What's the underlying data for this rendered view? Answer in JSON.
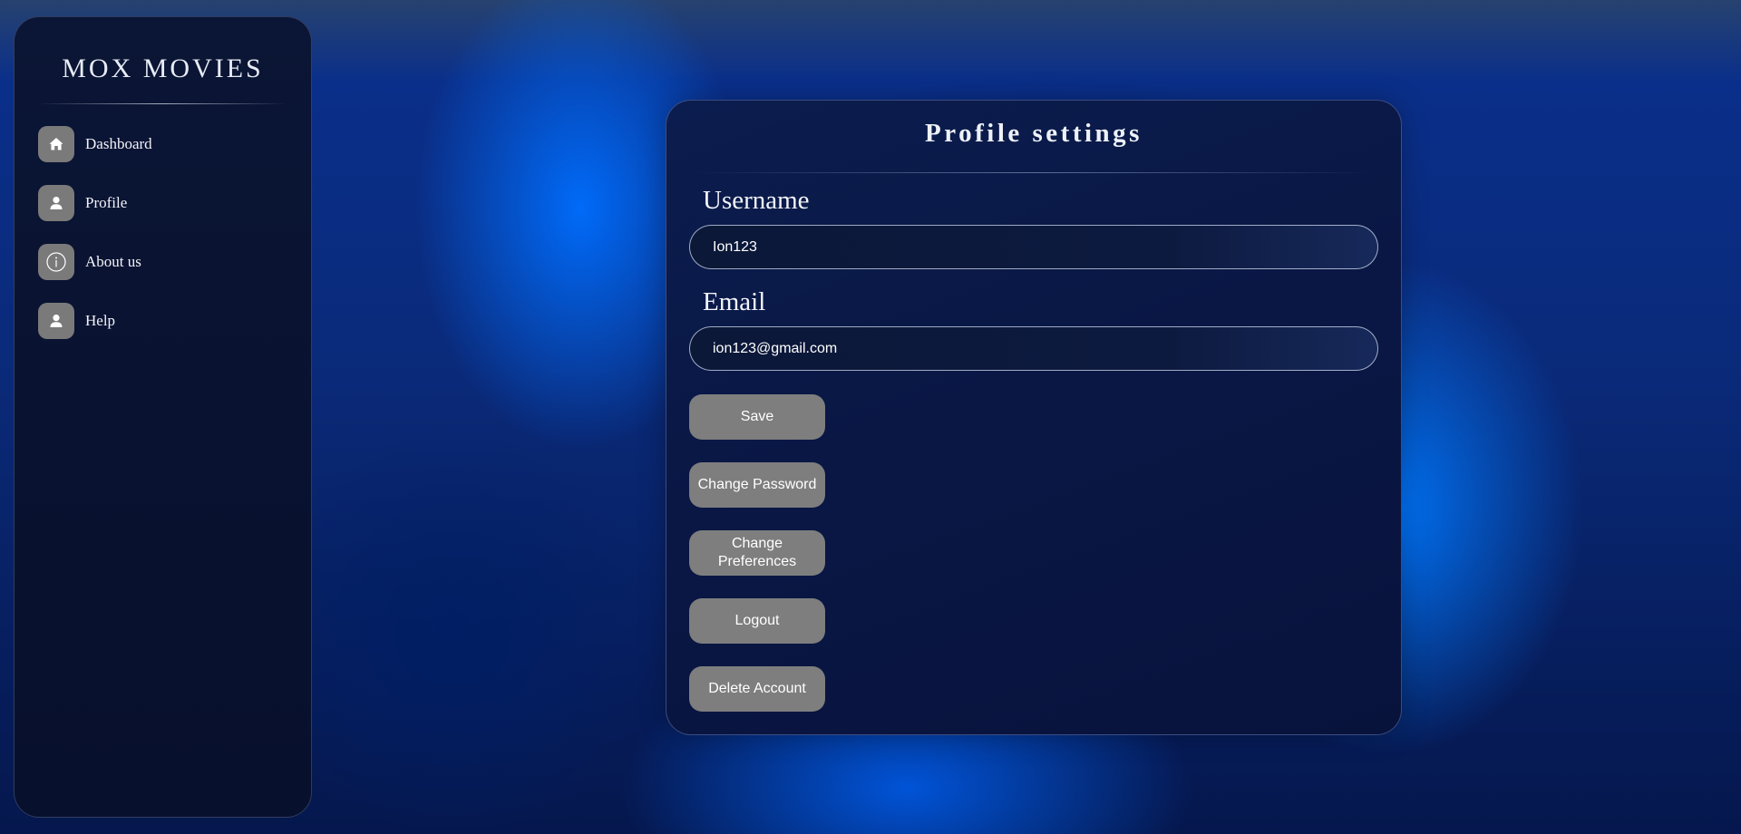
{
  "sidebar": {
    "brand": "MOX MOVIES",
    "items": [
      {
        "label": "Dashboard",
        "icon": "home-icon"
      },
      {
        "label": "Profile",
        "icon": "user-icon"
      },
      {
        "label": "About us",
        "icon": "info-icon"
      },
      {
        "label": "Help",
        "icon": "user-icon"
      }
    ]
  },
  "profile": {
    "title": "Profile settings",
    "username_label": "Username",
    "username_value": "Ion123",
    "email_label": "Email",
    "email_value": "ion123@gmail.com",
    "buttons": {
      "save": "Save",
      "change_password": "Change Password",
      "change_preferences": "Change Preferences",
      "logout": "Logout",
      "delete_account": "Delete Account"
    }
  },
  "colors": {
    "accent": "#0066ff",
    "button_bg": "#7e7e7e",
    "panel_bg": "#0a1745"
  }
}
